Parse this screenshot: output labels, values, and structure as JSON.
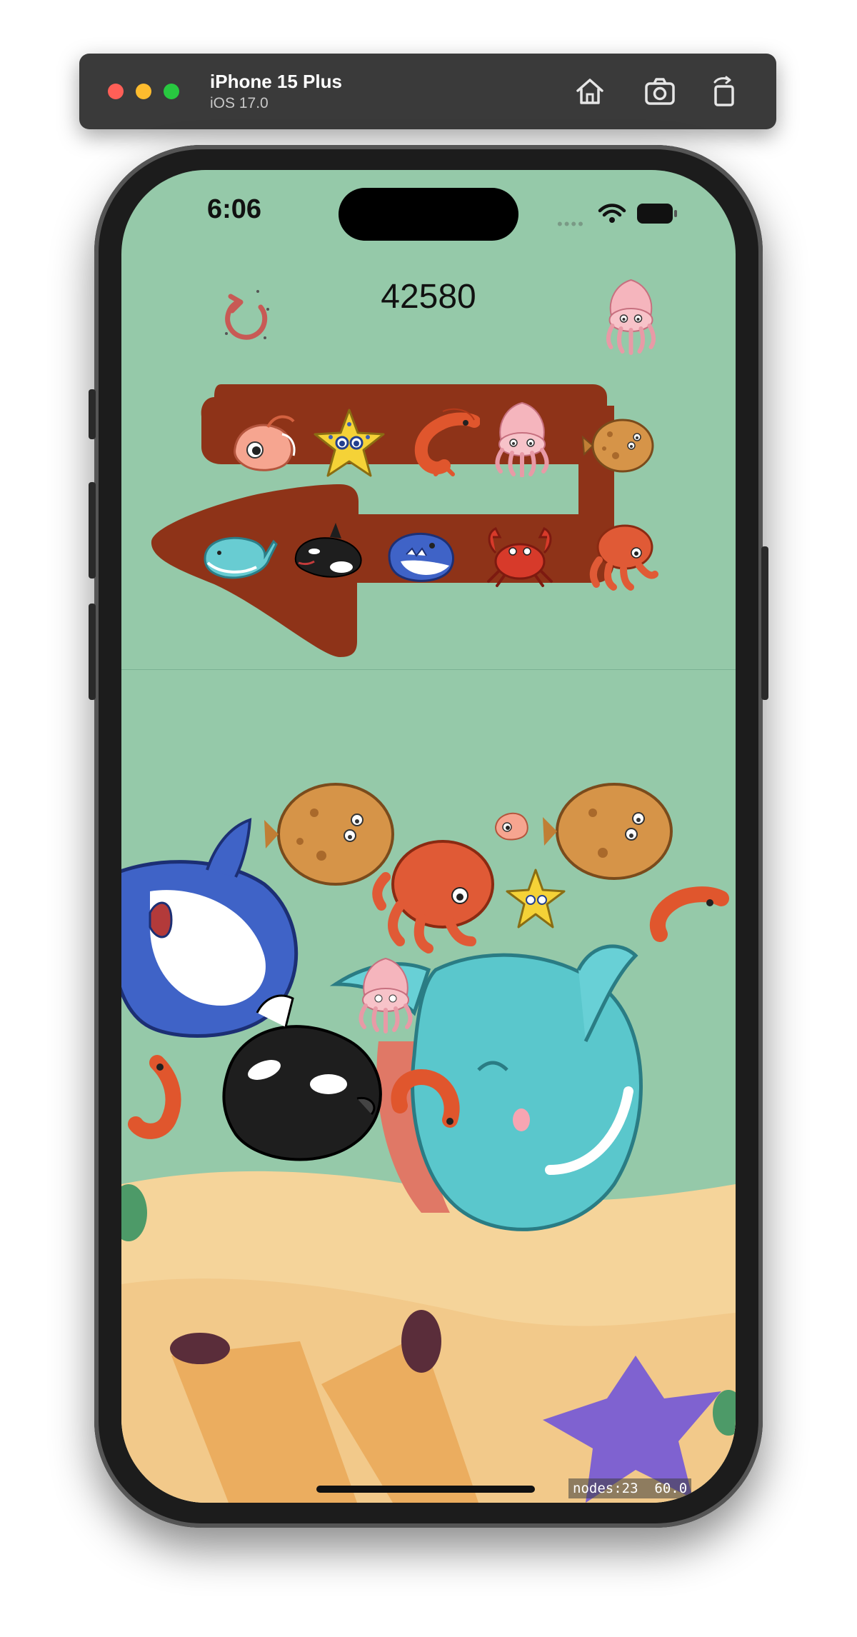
{
  "simulator": {
    "device_name": "iPhone 15 Plus",
    "os_version": "iOS 17.0",
    "buttons": [
      "home-icon",
      "screenshot-icon",
      "rotate-icon"
    ]
  },
  "status_bar": {
    "time": "6:06",
    "icons": [
      "wifi-icon",
      "battery-icon"
    ]
  },
  "game": {
    "score": "42580",
    "restart_icon": "restart-icon",
    "next_piece": "squid",
    "queue": [
      "goldfish",
      "starfish",
      "shrimp",
      "squid",
      "flounder",
      "octopus",
      "crab",
      "shark",
      "orca",
      "whale"
    ],
    "colors": {
      "background": "#95c9a9",
      "path": "#8e3318",
      "accent": "#c0504d"
    }
  },
  "debug": {
    "nodes": "nodes:23",
    "fps": "60.0"
  }
}
